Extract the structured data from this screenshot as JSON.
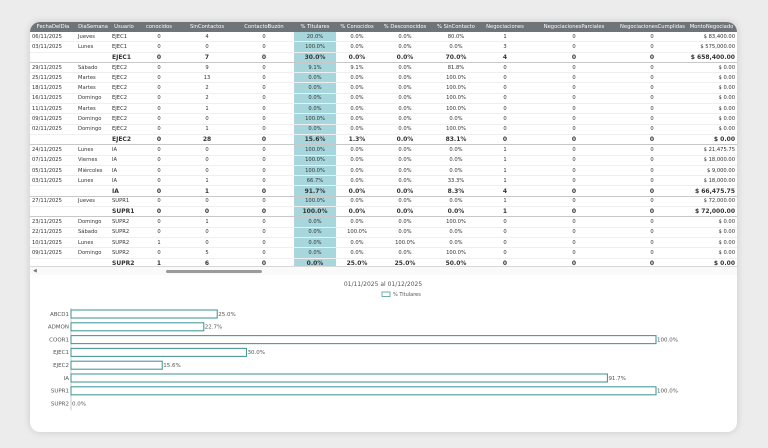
{
  "table": {
    "columns": [
      "FechaDelDia",
      "DiaSemana",
      "Usuario",
      "conocidos",
      "SinContactos",
      "ContactoBuzón",
      "% Titulares",
      "% Conocidos",
      "% Desconocidos",
      "% SinContacto",
      "Negociaciones",
      "NegociacionesParciales",
      "NegociacionesCumplidas",
      "MontoNegociado"
    ],
    "rows": [
      {
        "type": "row",
        "cells": [
          "06/11/2025",
          "Jueves",
          "EJEC1",
          "0",
          "4",
          "0",
          "20.0%",
          "0.0%",
          "0.0%",
          "80.0%",
          "1",
          "0",
          "0",
          "$ 83,400.00"
        ]
      },
      {
        "type": "row",
        "cells": [
          "03/11/2025",
          "Lunes",
          "EJEC1",
          "0",
          "0",
          "0",
          "100.0%",
          "0.0%",
          "0.0%",
          "0.0%",
          "3",
          "0",
          "0",
          "$ 575,000.00"
        ]
      },
      {
        "type": "subtotal",
        "cells": [
          "",
          "",
          "EJEC1",
          "0",
          "7",
          "0",
          "30.0%",
          "0.0%",
          "0.0%",
          "70.0%",
          "4",
          "0",
          "0",
          "$ 658,400.00"
        ]
      },
      {
        "type": "row",
        "cells": [
          "29/11/2025",
          "Sábado",
          "EJEC2",
          "0",
          "9",
          "0",
          "9.1%",
          "9.1%",
          "0.0%",
          "81.8%",
          "0",
          "0",
          "0",
          "$ 0.00"
        ]
      },
      {
        "type": "row",
        "cells": [
          "25/11/2025",
          "Martes",
          "EJEC2",
          "0",
          "13",
          "0",
          "0.0%",
          "0.0%",
          "0.0%",
          "100.0%",
          "0",
          "0",
          "0",
          "$ 0.00"
        ]
      },
      {
        "type": "row",
        "cells": [
          "18/11/2025",
          "Martes",
          "EJEC2",
          "0",
          "2",
          "0",
          "0.0%",
          "0.0%",
          "0.0%",
          "100.0%",
          "0",
          "0",
          "0",
          "$ 0.00"
        ]
      },
      {
        "type": "row",
        "cells": [
          "16/11/2025",
          "Domingo",
          "EJEC2",
          "0",
          "2",
          "0",
          "0.0%",
          "0.0%",
          "0.0%",
          "100.0%",
          "0",
          "0",
          "0",
          "$ 0.00"
        ]
      },
      {
        "type": "row",
        "cells": [
          "11/11/2025",
          "Martes",
          "EJEC2",
          "0",
          "1",
          "0",
          "0.0%",
          "0.0%",
          "0.0%",
          "100.0%",
          "0",
          "0",
          "0",
          "$ 0.00"
        ]
      },
      {
        "type": "row",
        "cells": [
          "09/11/2025",
          "Domingo",
          "EJEC2",
          "0",
          "0",
          "0",
          "100.0%",
          "0.0%",
          "0.0%",
          "0.0%",
          "0",
          "0",
          "0",
          "$ 0.00"
        ]
      },
      {
        "type": "row",
        "cells": [
          "02/11/2025",
          "Domingo",
          "EJEC2",
          "0",
          "1",
          "0",
          "0.0%",
          "0.0%",
          "0.0%",
          "100.0%",
          "0",
          "0",
          "0",
          "$ 0.00"
        ]
      },
      {
        "type": "subtotal",
        "cells": [
          "",
          "",
          "EJEC2",
          "0",
          "28",
          "0",
          "15.6%",
          "1.3%",
          "0.0%",
          "83.1%",
          "0",
          "0",
          "0",
          "$ 0.00"
        ]
      },
      {
        "type": "row",
        "cells": [
          "24/11/2025",
          "Lunes",
          "IA",
          "0",
          "0",
          "0",
          "100.0%",
          "0.0%",
          "0.0%",
          "0.0%",
          "1",
          "0",
          "0",
          "$ 21,475.75"
        ]
      },
      {
        "type": "row",
        "cells": [
          "07/11/2025",
          "Viernes",
          "IA",
          "0",
          "0",
          "0",
          "100.0%",
          "0.0%",
          "0.0%",
          "0.0%",
          "1",
          "0",
          "0",
          "$ 18,000.00"
        ]
      },
      {
        "type": "row",
        "cells": [
          "05/11/2025",
          "Miércoles",
          "IA",
          "0",
          "0",
          "0",
          "100.0%",
          "0.0%",
          "0.0%",
          "0.0%",
          "1",
          "0",
          "0",
          "$ 9,000.00"
        ]
      },
      {
        "type": "row",
        "cells": [
          "03/11/2025",
          "Lunes",
          "IA",
          "0",
          "1",
          "0",
          "66.7%",
          "0.0%",
          "0.0%",
          "33.3%",
          "1",
          "0",
          "0",
          "$ 18,000.00"
        ]
      },
      {
        "type": "subtotal",
        "cells": [
          "",
          "",
          "IA",
          "0",
          "1",
          "0",
          "91.7%",
          "0.0%",
          "0.0%",
          "8.3%",
          "4",
          "0",
          "0",
          "$ 66,475.75"
        ]
      },
      {
        "type": "row",
        "cells": [
          "27/11/2025",
          "Jueves",
          "SUPR1",
          "0",
          "0",
          "0",
          "100.0%",
          "0.0%",
          "0.0%",
          "0.0%",
          "1",
          "0",
          "0",
          "$ 72,000.00"
        ]
      },
      {
        "type": "subtotal",
        "cells": [
          "",
          "",
          "SUPR1",
          "0",
          "0",
          "0",
          "100.0%",
          "0.0%",
          "0.0%",
          "0.0%",
          "1",
          "0",
          "0",
          "$ 72,000.00"
        ]
      },
      {
        "type": "row",
        "cells": [
          "23/11/2025",
          "Domingo",
          "SUPR2",
          "0",
          "1",
          "0",
          "0.0%",
          "0.0%",
          "0.0%",
          "100.0%",
          "0",
          "0",
          "0",
          "$ 0.00"
        ]
      },
      {
        "type": "row",
        "cells": [
          "22/11/2025",
          "Sábado",
          "SUPR2",
          "0",
          "0",
          "0",
          "0.0%",
          "100.0%",
          "0.0%",
          "0.0%",
          "0",
          "0",
          "0",
          "$ 0.00"
        ]
      },
      {
        "type": "row",
        "cells": [
          "10/11/2025",
          "Lunes",
          "SUPR2",
          "1",
          "0",
          "0",
          "0.0%",
          "0.0%",
          "100.0%",
          "0.0%",
          "0",
          "0",
          "0",
          "$ 0.00"
        ]
      },
      {
        "type": "row",
        "cells": [
          "09/11/2025",
          "Domingo",
          "SUPR2",
          "0",
          "5",
          "0",
          "0.0%",
          "0.0%",
          "0.0%",
          "100.0%",
          "0",
          "0",
          "0",
          "$ 0.00"
        ]
      },
      {
        "type": "subtotal",
        "cells": [
          "",
          "",
          "SUPR2",
          "1",
          "6",
          "0",
          "0.0%",
          "25.0%",
          "25.0%",
          "50.0%",
          "0",
          "0",
          "0",
          "$ 0.00"
        ]
      }
    ]
  },
  "scroll": {
    "left_arrow_glyph": "◀"
  },
  "chart_data": {
    "type": "bar",
    "orientation": "horizontal",
    "title": "01/11/2025  al  01/12/2025",
    "legend": "top-center",
    "categories": [
      "ABCD1",
      "ADMON",
      "COOR1",
      "EJEC1",
      "EJEC2",
      "IA",
      "SUPR1",
      "SUPR2"
    ],
    "series": [
      {
        "name": "% Titulares",
        "values": [
          25.0,
          22.7,
          100.0,
          30.0,
          15.6,
          91.7,
          100.0,
          0.0
        ]
      }
    ],
    "value_labels": [
      "25.0%",
      "22.7%",
      "100.0%",
      "30.0%",
      "15.6%",
      "91.7%",
      "100.0%",
      "0.0%"
    ],
    "xlim": [
      0,
      100
    ],
    "grid": false,
    "colors": {
      "bar_stroke": "#4c9a9b",
      "bar_fill": "#ffffff"
    }
  }
}
